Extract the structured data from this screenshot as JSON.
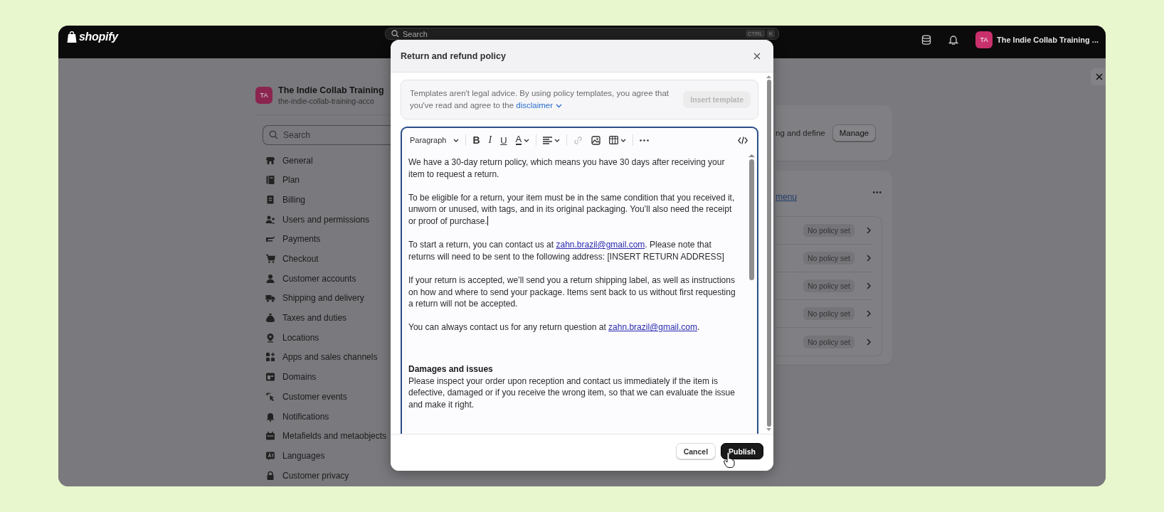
{
  "topbar": {
    "logo": "shopify",
    "search": {
      "placeholder": "Search",
      "shortcut": [
        "CTRL",
        "K"
      ]
    },
    "store_avatar": "TA",
    "store_name": "The Indie Collab Training ..."
  },
  "sidebar": {
    "avatar": "TA",
    "store_name": "The Indie Collab Training",
    "store_domain": "the-indie-collab-training-acco",
    "search": {
      "placeholder": "Search"
    },
    "items": [
      {
        "label": "General"
      },
      {
        "label": "Plan"
      },
      {
        "label": "Billing"
      },
      {
        "label": "Users and permissions"
      },
      {
        "label": "Payments"
      },
      {
        "label": "Checkout"
      },
      {
        "label": "Customer accounts"
      },
      {
        "label": "Shipping and delivery"
      },
      {
        "label": "Taxes and duties"
      },
      {
        "label": "Locations"
      },
      {
        "label": "Apps and sales channels"
      },
      {
        "label": "Domains"
      },
      {
        "label": "Customer events"
      },
      {
        "label": "Notifications"
      },
      {
        "label": "Metafields and metaobjects"
      },
      {
        "label": "Languages"
      },
      {
        "label": "Customer privacy"
      }
    ]
  },
  "content": {
    "card_text": "ng and define",
    "manage_button": "Manage",
    "menu_link": "menu",
    "more": "•••",
    "policies": [
      {
        "badge": "No policy set"
      },
      {
        "badge": "No policy set"
      },
      {
        "badge": "No policy set"
      },
      {
        "badge": "No policy set"
      },
      {
        "badge": "No policy set"
      }
    ]
  },
  "modal": {
    "title": "Return and refund policy",
    "notice": {
      "text": "Templates aren't legal advice. By using policy templates, you agree that you've read and agree to the",
      "link": "disclaimer",
      "button": {
        "label": "Insert template",
        "disabled": true
      }
    },
    "toolbar": [
      {
        "kind": "format",
        "label": "Paragraph",
        "disabled": false
      },
      {
        "kind": "divider"
      },
      {
        "kind": "bold",
        "label": "B",
        "disabled": false
      },
      {
        "kind": "italic",
        "label": "I",
        "disabled": false
      },
      {
        "kind": "underline",
        "label": "U",
        "disabled": false
      },
      {
        "kind": "color",
        "label": "A",
        "disabled": false
      },
      {
        "kind": "divider"
      },
      {
        "kind": "align",
        "disabled": false
      },
      {
        "kind": "divider"
      },
      {
        "kind": "link",
        "disabled": true
      },
      {
        "kind": "image",
        "disabled": false
      },
      {
        "kind": "table",
        "disabled": false
      },
      {
        "kind": "divider"
      },
      {
        "kind": "more",
        "disabled": false
      },
      {
        "kind": "code",
        "disabled": false
      }
    ],
    "blocks": [
      {
        "kind": "paragraph",
        "caret": false,
        "parts": [
          {
            "kind": "text",
            "text": "We have a 30-day return policy, which means you have 30 days after receiving your item to request a return."
          }
        ]
      },
      {
        "kind": "paragraph",
        "caret": true,
        "parts": [
          {
            "kind": "text",
            "text": "To be eligible for a return, your item must be in the same condition that you received it, unworn or unused, with tags, and in its original packaging. You’ll also need the receipt or proof of purchase."
          }
        ]
      },
      {
        "kind": "paragraph",
        "caret": false,
        "parts": [
          {
            "kind": "text",
            "text": "To start a return, you can contact us at "
          },
          {
            "kind": "link",
            "text": "zahn.brazil@gmail.com"
          },
          {
            "kind": "text",
            "text": ". Please note that returns will need to be sent to the following address: [INSERT RETURN ADDRESS]"
          }
        ]
      },
      {
        "kind": "paragraph",
        "caret": false,
        "parts": [
          {
            "kind": "text",
            "text": "If your return is accepted, we’ll send you a return shipping label, as well as instructions on how and where to send your package. Items sent back to us without first requesting a return will not be accepted."
          }
        ]
      },
      {
        "kind": "paragraph",
        "caret": false,
        "parts": [
          {
            "kind": "text",
            "text": "You can always contact us for any return question at "
          },
          {
            "kind": "link",
            "text": "zahn.brazil@gmail.com"
          },
          {
            "kind": "text",
            "text": "."
          }
        ]
      },
      {
        "kind": "heading",
        "caret": false,
        "parts": [
          {
            "kind": "text",
            "text": "Damages and issues"
          }
        ]
      },
      {
        "kind": "paragraph",
        "caret": false,
        "parts": [
          {
            "kind": "text",
            "text": "Please inspect your order upon reception and contact us immediately if the item is defective, damaged or if you receive the wrong item, so that we can evaluate the issue and make it right."
          }
        ]
      }
    ],
    "buttons": [
      {
        "kind": "secondary",
        "label": "Cancel"
      },
      {
        "kind": "primary",
        "label": "Publish"
      }
    ]
  }
}
